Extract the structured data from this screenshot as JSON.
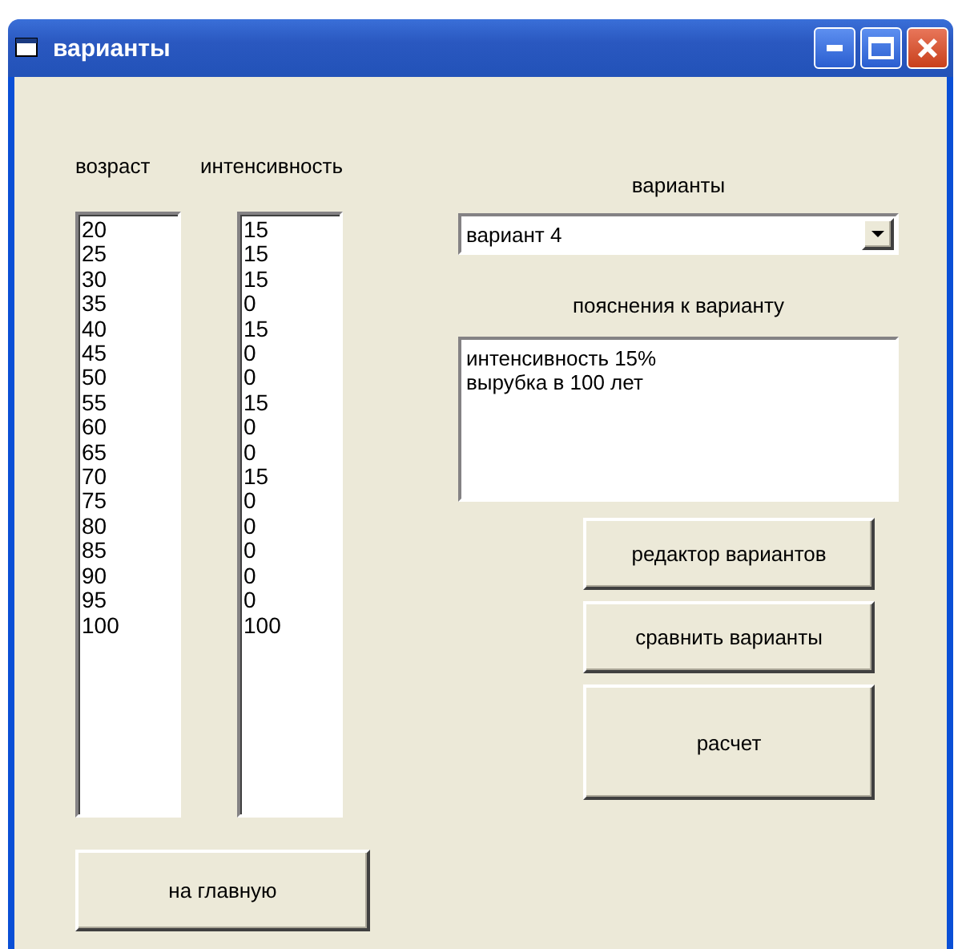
{
  "window": {
    "title": "варианты"
  },
  "age_list": {
    "label": "возраст",
    "items": [
      "20",
      "25",
      "30",
      "35",
      "40",
      "45",
      "50",
      "55",
      "60",
      "65",
      "70",
      "75",
      "80",
      "85",
      "90",
      "95",
      "100"
    ]
  },
  "intensity_list": {
    "label": "интенсивность",
    "items": [
      "15",
      "15",
      "15",
      "0",
      "15",
      "0",
      "0",
      "15",
      "0",
      "0",
      "15",
      "0",
      "0",
      "0",
      "0",
      "0",
      "100"
    ]
  },
  "variants": {
    "label": "варианты",
    "value": "вариант 4"
  },
  "notes": {
    "label": "пояснения к варианту",
    "value": "интенсивность 15%\nвырубка в 100 лет"
  },
  "buttons": [
    {
      "label": "редактор вариантов",
      "kind": "small"
    },
    {
      "label": "сравнить варианты",
      "kind": "small"
    },
    {
      "label": "расчет",
      "kind": "large"
    }
  ],
  "home_button": {
    "label": "на главную"
  }
}
